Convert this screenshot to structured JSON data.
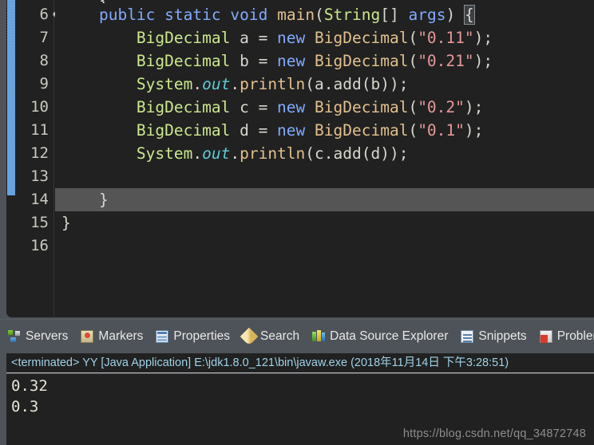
{
  "editor": {
    "lines": [
      {
        "num": "",
        "clipped": true,
        "current": false,
        "marker": false,
        "tokens": [
          {
            "t": "    ",
            "c": "plain"
          },
          {
            "t": "{",
            "c": "punct"
          }
        ]
      },
      {
        "num": "6",
        "clipped": false,
        "current": false,
        "marker": true,
        "tokens": [
          {
            "t": "    ",
            "c": "plain"
          },
          {
            "t": "public",
            "c": "kw"
          },
          {
            "t": " ",
            "c": "plain"
          },
          {
            "t": "static",
            "c": "kw"
          },
          {
            "t": " ",
            "c": "plain"
          },
          {
            "t": "void",
            "c": "kw"
          },
          {
            "t": " ",
            "c": "plain"
          },
          {
            "t": "main",
            "c": "meth"
          },
          {
            "t": "(",
            "c": "punct"
          },
          {
            "t": "String",
            "c": "type"
          },
          {
            "t": "[] ",
            "c": "punct"
          },
          {
            "t": "args",
            "c": "kw"
          },
          {
            "t": ") ",
            "c": "punct"
          },
          {
            "t": "{",
            "c": "brace-hi"
          }
        ]
      },
      {
        "num": "7",
        "clipped": false,
        "current": false,
        "marker": false,
        "tokens": [
          {
            "t": "        ",
            "c": "plain"
          },
          {
            "t": "BigDecimal",
            "c": "type"
          },
          {
            "t": " a ",
            "c": "plain"
          },
          {
            "t": "= ",
            "c": "punct"
          },
          {
            "t": "new",
            "c": "kw"
          },
          {
            "t": " ",
            "c": "plain"
          },
          {
            "t": "BigDecimal",
            "c": "meth"
          },
          {
            "t": "(",
            "c": "punct"
          },
          {
            "t": "\"0.11\"",
            "c": "str"
          },
          {
            "t": ");",
            "c": "punct"
          }
        ]
      },
      {
        "num": "8",
        "clipped": false,
        "current": false,
        "marker": false,
        "tokens": [
          {
            "t": "        ",
            "c": "plain"
          },
          {
            "t": "BigDecimal",
            "c": "type"
          },
          {
            "t": " b ",
            "c": "plain"
          },
          {
            "t": "= ",
            "c": "punct"
          },
          {
            "t": "new",
            "c": "kw"
          },
          {
            "t": " ",
            "c": "plain"
          },
          {
            "t": "BigDecimal",
            "c": "meth"
          },
          {
            "t": "(",
            "c": "punct"
          },
          {
            "t": "\"0.21\"",
            "c": "str"
          },
          {
            "t": ");",
            "c": "punct"
          }
        ]
      },
      {
        "num": "9",
        "clipped": false,
        "current": false,
        "marker": false,
        "tokens": [
          {
            "t": "        ",
            "c": "plain"
          },
          {
            "t": "System",
            "c": "type"
          },
          {
            "t": ".",
            "c": "punct"
          },
          {
            "t": "out",
            "c": "field"
          },
          {
            "t": ".",
            "c": "punct"
          },
          {
            "t": "println",
            "c": "meth"
          },
          {
            "t": "(a.",
            "c": "punct"
          },
          {
            "t": "add",
            "c": "plain"
          },
          {
            "t": "(b));",
            "c": "punct"
          }
        ]
      },
      {
        "num": "10",
        "clipped": false,
        "current": false,
        "marker": false,
        "tokens": [
          {
            "t": "        ",
            "c": "plain"
          },
          {
            "t": "BigDecimal",
            "c": "type"
          },
          {
            "t": " c ",
            "c": "plain"
          },
          {
            "t": "= ",
            "c": "punct"
          },
          {
            "t": "new",
            "c": "kw"
          },
          {
            "t": " ",
            "c": "plain"
          },
          {
            "t": "BigDecimal",
            "c": "meth"
          },
          {
            "t": "(",
            "c": "punct"
          },
          {
            "t": "\"0.2\"",
            "c": "str"
          },
          {
            "t": ");",
            "c": "punct"
          }
        ]
      },
      {
        "num": "11",
        "clipped": false,
        "current": false,
        "marker": false,
        "tokens": [
          {
            "t": "        ",
            "c": "plain"
          },
          {
            "t": "BigDecimal",
            "c": "type"
          },
          {
            "t": " d ",
            "c": "plain"
          },
          {
            "t": "= ",
            "c": "punct"
          },
          {
            "t": "new",
            "c": "kw"
          },
          {
            "t": " ",
            "c": "plain"
          },
          {
            "t": "BigDecimal",
            "c": "meth"
          },
          {
            "t": "(",
            "c": "punct"
          },
          {
            "t": "\"0.1\"",
            "c": "str"
          },
          {
            "t": ");",
            "c": "punct"
          }
        ]
      },
      {
        "num": "12",
        "clipped": false,
        "current": false,
        "marker": false,
        "tokens": [
          {
            "t": "        ",
            "c": "plain"
          },
          {
            "t": "System",
            "c": "type"
          },
          {
            "t": ".",
            "c": "punct"
          },
          {
            "t": "out",
            "c": "field"
          },
          {
            "t": ".",
            "c": "punct"
          },
          {
            "t": "println",
            "c": "meth"
          },
          {
            "t": "(c.",
            "c": "punct"
          },
          {
            "t": "add",
            "c": "plain"
          },
          {
            "t": "(d));",
            "c": "punct"
          }
        ]
      },
      {
        "num": "13",
        "clipped": false,
        "current": false,
        "marker": false,
        "tokens": []
      },
      {
        "num": "14",
        "clipped": false,
        "current": true,
        "marker": false,
        "tokens": [
          {
            "t": "    ",
            "c": "plain"
          },
          {
            "t": "}",
            "c": "punct"
          }
        ]
      },
      {
        "num": "15",
        "clipped": false,
        "current": false,
        "marker": false,
        "tokens": [
          {
            "t": "}",
            "c": "punct"
          }
        ]
      },
      {
        "num": "16",
        "clipped": false,
        "current": false,
        "marker": false,
        "tokens": []
      }
    ],
    "colors": {
      "background": "#212121",
      "keyword": "#82aaff",
      "type": "#cbe88d",
      "field": "#5ecbd4",
      "method": "#e2c08d",
      "string": "#e79898",
      "plain": "#d7d7cf",
      "current_line": "#555555",
      "change_bar": "#2f7fd0"
    }
  },
  "view_tabs": [
    {
      "label": "Servers",
      "icon": "servers-icon"
    },
    {
      "label": "Markers",
      "icon": "markers-icon"
    },
    {
      "label": "Properties",
      "icon": "properties-icon"
    },
    {
      "label": "Search",
      "icon": "search-icon"
    },
    {
      "label": "Data Source Explorer",
      "icon": "data-source-explorer-icon"
    },
    {
      "label": "Snippets",
      "icon": "snippets-icon"
    },
    {
      "label": "Problems",
      "icon": "problems-icon"
    }
  ],
  "console": {
    "header": "<terminated> YY [Java Application] E:\\jdk1.8.0_121\\bin\\javaw.exe (2018年11月14日 下午3:28:51)",
    "output": [
      "0.32",
      "0.3"
    ]
  },
  "watermark": "https://blog.csdn.net/qq_34872748"
}
